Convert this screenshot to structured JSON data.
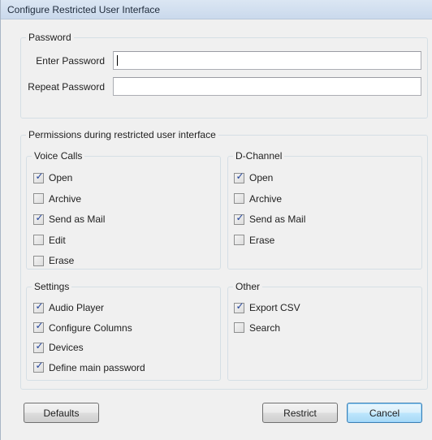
{
  "window": {
    "title": "Configure Restricted User Interface"
  },
  "password_group": {
    "legend": "Password",
    "enter_label": "Enter Password",
    "enter_value": "",
    "repeat_label": "Repeat Password",
    "repeat_value": ""
  },
  "permissions": {
    "legend": "Permissions during restricted user interface",
    "voice_calls": {
      "legend": "Voice Calls",
      "items": [
        {
          "label": "Open",
          "checked": true
        },
        {
          "label": "Archive",
          "checked": false
        },
        {
          "label": "Send as Mail",
          "checked": true
        },
        {
          "label": "Edit",
          "checked": false
        },
        {
          "label": "Erase",
          "checked": false
        }
      ]
    },
    "d_channel": {
      "legend": "D-Channel",
      "items": [
        {
          "label": "Open",
          "checked": true
        },
        {
          "label": "Archive",
          "checked": false
        },
        {
          "label": "Send as Mail",
          "checked": true
        },
        {
          "label": "Erase",
          "checked": false
        }
      ]
    },
    "settings": {
      "legend": "Settings",
      "items": [
        {
          "label": "Audio Player",
          "checked": true
        },
        {
          "label": "Configure Columns",
          "checked": true
        },
        {
          "label": "Devices",
          "checked": true
        },
        {
          "label": "Define main password",
          "checked": true
        }
      ]
    },
    "other": {
      "legend": "Other",
      "items": [
        {
          "label": "Export CSV",
          "checked": true
        },
        {
          "label": "Search",
          "checked": false
        }
      ]
    }
  },
  "buttons": {
    "defaults": "Defaults",
    "restrict": "Restrict",
    "cancel": "Cancel"
  },
  "check_glyph": "✓"
}
